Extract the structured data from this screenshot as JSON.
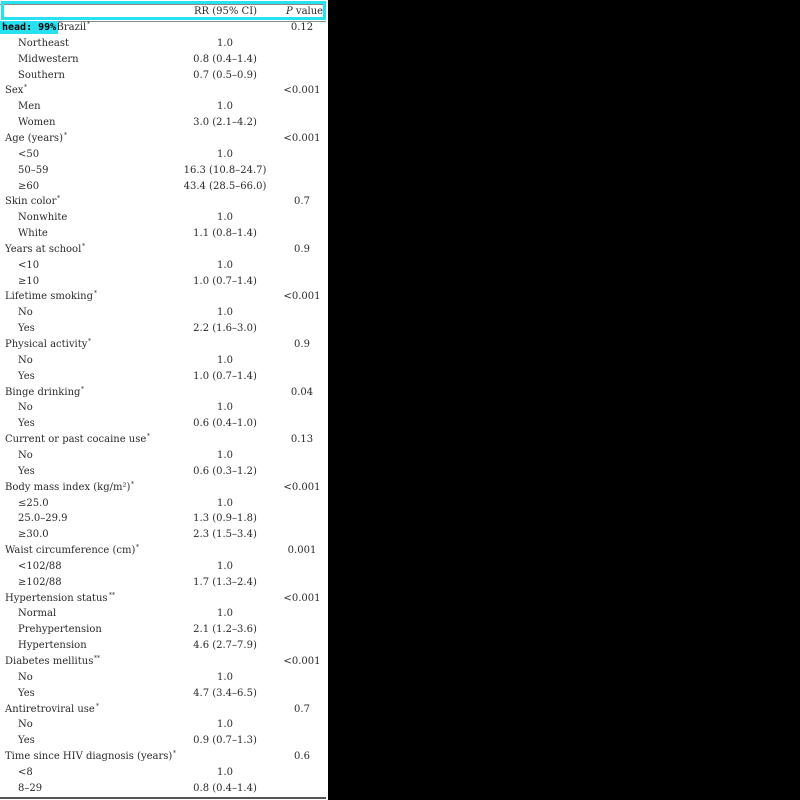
{
  "header": {
    "rr": "RR (95% CI)",
    "p_value_italic": "P",
    "p_value_rest": " value"
  },
  "detection": {
    "label": "head:  99%",
    "color": "#27e0f0"
  },
  "rows": [
    {
      "kind": "group",
      "label": "Region in Brazil",
      "sup": "*",
      "rr": "",
      "p": "0.12"
    },
    {
      "kind": "sub",
      "label": "Northeast",
      "rr": "1.0",
      "p": ""
    },
    {
      "kind": "sub",
      "label": "Midwestern",
      "rr": "0.8 (0.4–1.4)",
      "p": ""
    },
    {
      "kind": "sub",
      "label": "Southern",
      "rr": "0.7 (0.5–0.9)",
      "p": ""
    },
    {
      "kind": "group",
      "label": "Sex",
      "sup": "*",
      "rr": "",
      "p": "<0.001"
    },
    {
      "kind": "sub",
      "label": "Men",
      "rr": "1.0",
      "p": ""
    },
    {
      "kind": "sub",
      "label": "Women",
      "rr": "3.0 (2.1–4.2)",
      "p": ""
    },
    {
      "kind": "group",
      "label": "Age (years)",
      "sup": "*",
      "rr": "",
      "p": "<0.001"
    },
    {
      "kind": "sub",
      "label": "<50",
      "rr": "1.0",
      "p": ""
    },
    {
      "kind": "sub",
      "label": "50–59",
      "rr": "16.3 (10.8–24.7)",
      "p": ""
    },
    {
      "kind": "sub",
      "label": "≥60",
      "rr": "43.4 (28.5–66.0)",
      "p": ""
    },
    {
      "kind": "group",
      "label": "Skin color",
      "sup": "*",
      "rr": "",
      "p": "0.7"
    },
    {
      "kind": "sub",
      "label": "Nonwhite",
      "rr": "1.0",
      "p": ""
    },
    {
      "kind": "sub",
      "label": "White",
      "rr": "1.1 (0.8–1.4)",
      "p": ""
    },
    {
      "kind": "group",
      "label": "Years at school",
      "sup": "*",
      "rr": "",
      "p": "0.9"
    },
    {
      "kind": "sub",
      "label": "<10",
      "rr": "1.0",
      "p": ""
    },
    {
      "kind": "sub",
      "label": "≥10",
      "rr": "1.0 (0.7–1.4)",
      "p": ""
    },
    {
      "kind": "group",
      "label": "Lifetime smoking",
      "sup": "*",
      "rr": "",
      "p": "<0.001"
    },
    {
      "kind": "sub",
      "label": "No",
      "rr": "1.0",
      "p": ""
    },
    {
      "kind": "sub",
      "label": "Yes",
      "rr": "2.2 (1.6–3.0)",
      "p": ""
    },
    {
      "kind": "group",
      "label": "Physical activity",
      "sup": "*",
      "rr": "",
      "p": "0.9"
    },
    {
      "kind": "sub",
      "label": "No",
      "rr": "1.0",
      "p": ""
    },
    {
      "kind": "sub",
      "label": "Yes",
      "rr": "1.0 (0.7–1.4)",
      "p": ""
    },
    {
      "kind": "group",
      "label": "Binge drinking",
      "sup": "*",
      "rr": "",
      "p": "0.04"
    },
    {
      "kind": "sub",
      "label": "No",
      "rr": "1.0",
      "p": ""
    },
    {
      "kind": "sub",
      "label": "Yes",
      "rr": "0.6 (0.4–1.0)",
      "p": ""
    },
    {
      "kind": "group",
      "label": "Current or past cocaine use",
      "sup": "*",
      "rr": "",
      "p": "0.13"
    },
    {
      "kind": "sub",
      "label": "No",
      "rr": "1.0",
      "p": ""
    },
    {
      "kind": "sub",
      "label": "Yes",
      "rr": "0.6 (0.3–1.2)",
      "p": ""
    },
    {
      "kind": "group",
      "label": "Body mass index (kg/m²)",
      "sup": "*",
      "rr": "",
      "p": "<0.001"
    },
    {
      "kind": "sub",
      "label": "≤25.0",
      "rr": "1.0",
      "p": ""
    },
    {
      "kind": "sub",
      "label": "25.0–29.9",
      "rr": "1.3 (0.9–1.8)",
      "p": ""
    },
    {
      "kind": "sub",
      "label": "≥30.0",
      "rr": "2.3 (1.5–3.4)",
      "p": ""
    },
    {
      "kind": "group",
      "label": "Waist circumference (cm)",
      "sup": "*",
      "rr": "",
      "p": "0.001"
    },
    {
      "kind": "sub",
      "label": "<102/88",
      "rr": "1.0",
      "p": ""
    },
    {
      "kind": "sub",
      "label": "≥102/88",
      "rr": "1.7 (1.3–2.4)",
      "p": ""
    },
    {
      "kind": "group",
      "label": "Hypertension status",
      "sup": "**",
      "rr": "",
      "p": "<0.001"
    },
    {
      "kind": "sub",
      "label": "Normal",
      "rr": "1.0",
      "p": ""
    },
    {
      "kind": "sub",
      "label": "Prehypertension",
      "rr": "2.1 (1.2–3.6)",
      "p": ""
    },
    {
      "kind": "sub",
      "label": "Hypertension",
      "rr": "4.6 (2.7–7.9)",
      "p": ""
    },
    {
      "kind": "group",
      "label": "Diabetes mellitus",
      "sup": "**",
      "rr": "",
      "p": "<0.001"
    },
    {
      "kind": "sub",
      "label": "No",
      "rr": "1.0",
      "p": ""
    },
    {
      "kind": "sub",
      "label": "Yes",
      "rr": "4.7 (3.4–6.5)",
      "p": ""
    },
    {
      "kind": "group",
      "label": "Antiretroviral use",
      "sup": "*",
      "rr": "",
      "p": "0.7"
    },
    {
      "kind": "sub",
      "label": "No",
      "rr": "1.0",
      "p": ""
    },
    {
      "kind": "sub",
      "label": "Yes",
      "rr": "0.9 (0.7–1.3)",
      "p": ""
    },
    {
      "kind": "group",
      "label": "Time since HIV diagnosis (years)",
      "sup": "*",
      "rr": "",
      "p": "0.6"
    },
    {
      "kind": "sub",
      "label": "<8",
      "rr": "1.0",
      "p": ""
    },
    {
      "kind": "sub",
      "label": "8–29",
      "rr": "0.8 (0.4–1.4)",
      "p": ""
    }
  ]
}
